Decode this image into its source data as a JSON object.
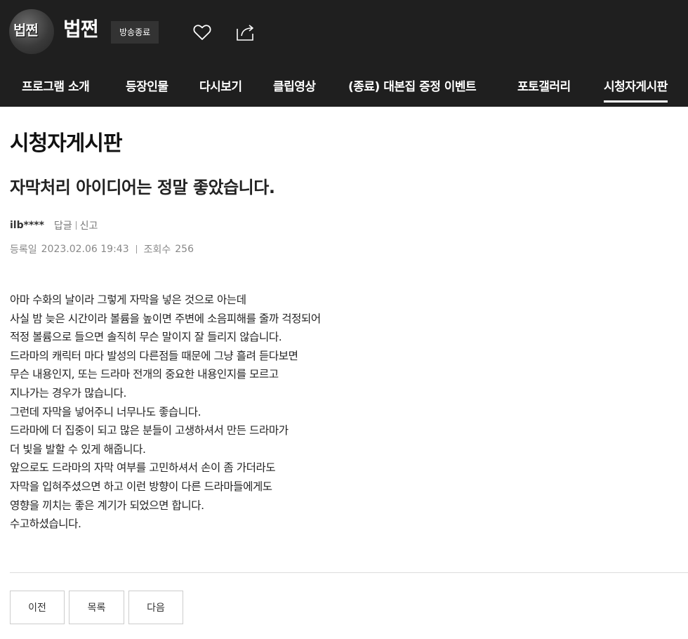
{
  "header": {
    "logo_text": "법쩐",
    "program_title": "법쩐",
    "status_badge": "방송종료",
    "favorite_icon": "heart-icon",
    "share_icon": "share-icon"
  },
  "nav": {
    "items": [
      {
        "label": "프로그램 소개",
        "active": false
      },
      {
        "label": "등장인물",
        "active": false
      },
      {
        "label": "다시보기",
        "active": false
      },
      {
        "label": "클립영상",
        "active": false
      },
      {
        "label": "(종료) 대본집 증정 이벤트",
        "active": false
      },
      {
        "label": "포토갤러리",
        "active": false
      },
      {
        "label": "시청자게시판",
        "active": true
      }
    ]
  },
  "board": {
    "title": "시청자게시판"
  },
  "post": {
    "title": "자막처리 아이디어는 정말 좋았습니다.",
    "author": "ilb****",
    "reply_label": "답글",
    "report_label": "신고",
    "date_label": "등록일",
    "date_value": "2023.02.06 19:43",
    "views_label": "조회수",
    "views_value": "256",
    "body_lines": [
      "아마 수화의 날이라 그렇게 자막을 넣은 것으로 아는데",
      "사실 밤 늦은 시간이라 볼륨을 높이면 주변에 소음피해를 줄까 걱정되어",
      "적정 볼륨으로 들으면 솔직히 무슨 말이지 잘 들리지 않습니다.",
      "드라마의 캐릭터 마다 발성의 다른점들 때문에 그냥 흘려 듣다보면",
      "무슨 내용인지, 또는 드라마 전개의 중요한 내용인지를 모르고",
      "지나가는 경우가 많습니다.",
      "그런데 자막을 넣어주니 너무나도 좋습니다.",
      "드라마에 더 집중이 되고 많은 분들이 고생하셔서 만든 드라마가",
      "더 빛을 발할 수 있게 해줍니다.",
      "앞으로도 드라마의 자막 여부를 고민하셔서 손이 좀 가더라도",
      "자막을 입혀주셨으면 하고 이런 방향이 다른 드라마들에게도",
      "영향을 끼치는 좋은 계기가 되었으면 합니다.",
      "수고하셨습니다."
    ]
  },
  "pager": {
    "prev": "이전",
    "list": "목록",
    "next": "다음"
  }
}
